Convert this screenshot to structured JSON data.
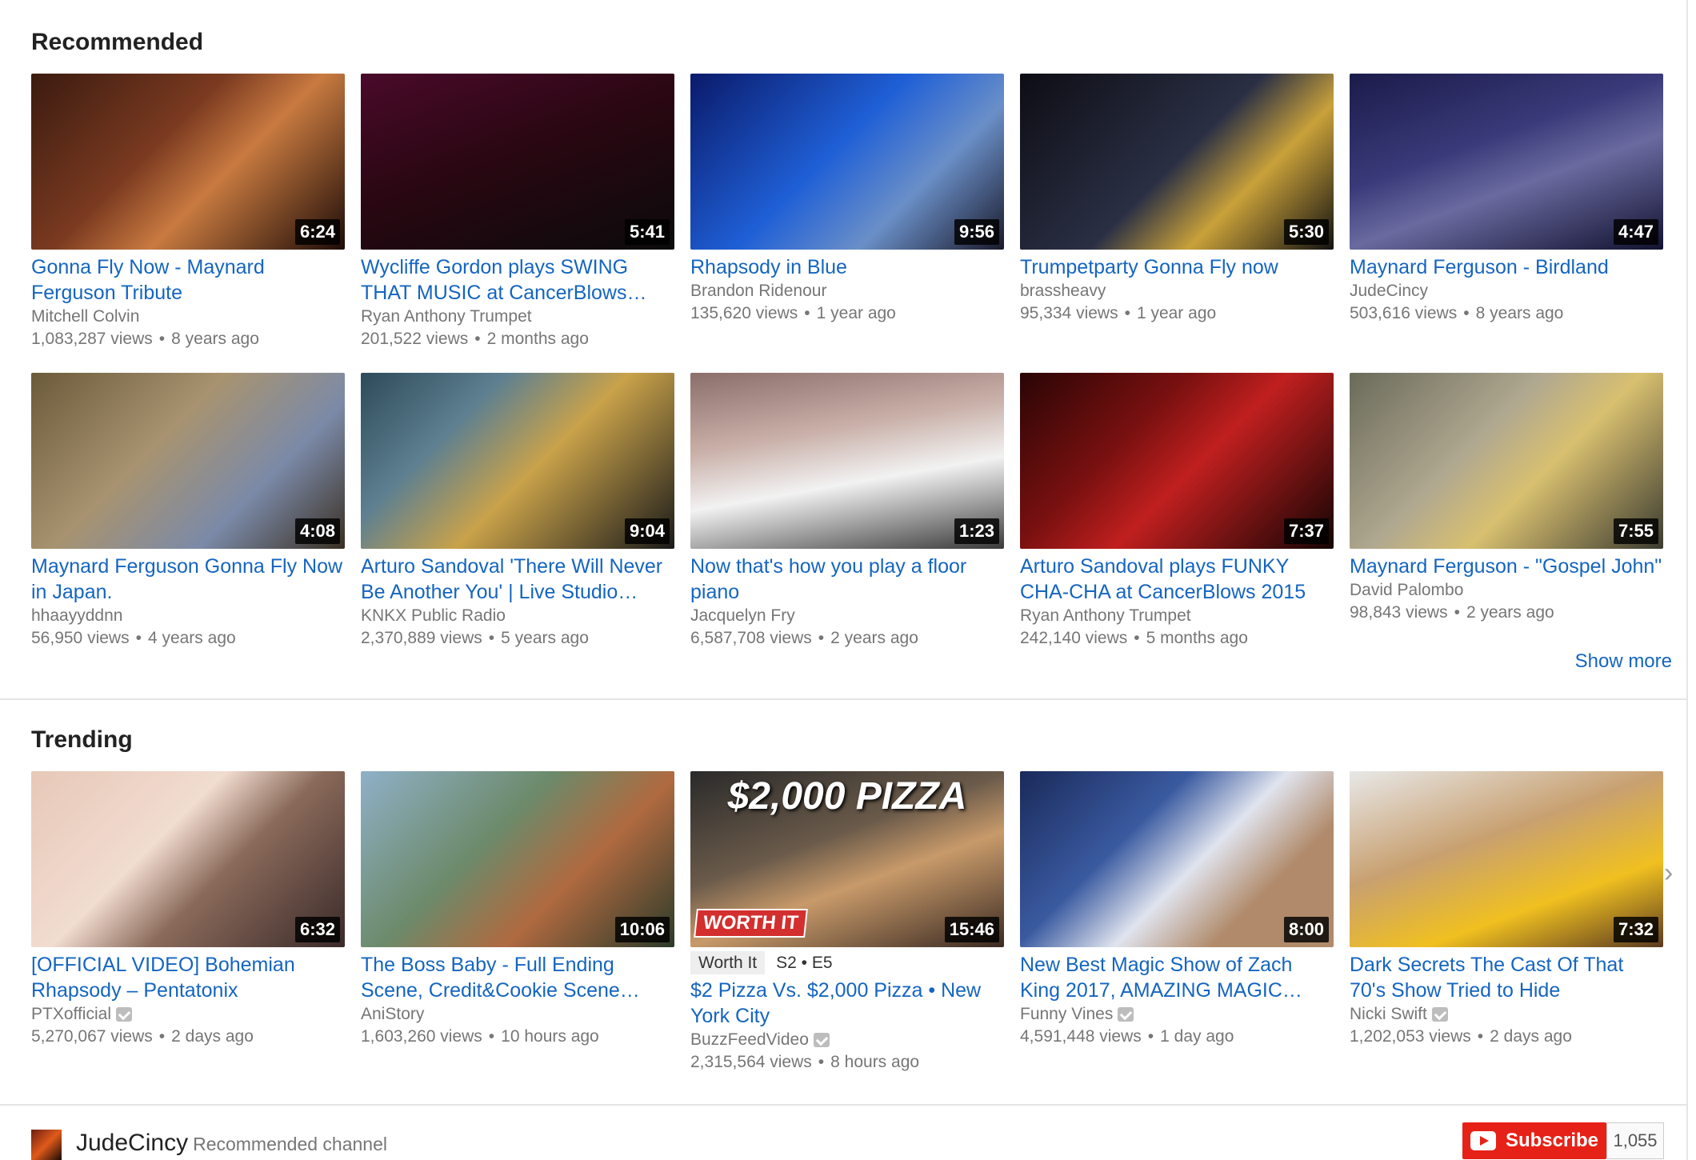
{
  "sections": {
    "recommended_title": "Recommended",
    "trending_title": "Trending",
    "show_more": "Show more"
  },
  "recommended": [
    {
      "title": "Gonna Fly Now - Maynard Ferguson Tribute",
      "channel": "Mitchell Colvin",
      "views": "1,083,287 views",
      "age": "8 years ago",
      "duration": "6:24"
    },
    {
      "title": "Wycliffe Gordon plays SWING THAT MUSIC at CancerBlows…",
      "channel": "Ryan Anthony Trumpet",
      "views": "201,522 views",
      "age": "2 months ago",
      "duration": "5:41"
    },
    {
      "title": "Rhapsody in Blue",
      "channel": "Brandon Ridenour",
      "views": "135,620 views",
      "age": "1 year ago",
      "duration": "9:56"
    },
    {
      "title": "Trumpetparty Gonna Fly now",
      "channel": "brassheavy",
      "views": "95,334 views",
      "age": "1 year ago",
      "duration": "5:30"
    },
    {
      "title": "Maynard Ferguson - Birdland",
      "channel": "JudeCincy",
      "views": "503,616 views",
      "age": "8 years ago",
      "duration": "4:47"
    },
    {
      "title": "Maynard Ferguson Gonna Fly Now in Japan.",
      "channel": "hhaayyddnn",
      "views": "56,950 views",
      "age": "4 years ago",
      "duration": "4:08"
    },
    {
      "title": "Arturo Sandoval 'There Will Never Be Another You' | Live Studio…",
      "channel": "KNKX Public Radio",
      "views": "2,370,889 views",
      "age": "5 years ago",
      "duration": "9:04"
    },
    {
      "title": "Now that's how you play a floor piano",
      "channel": "Jacquelyn Fry",
      "views": "6,587,708 views",
      "age": "2 years ago",
      "duration": "1:23"
    },
    {
      "title": "Arturo Sandoval plays FUNKY CHA-CHA at CancerBlows 2015",
      "channel": "Ryan Anthony Trumpet",
      "views": "242,140 views",
      "age": "5 months ago",
      "duration": "7:37"
    },
    {
      "title": "Maynard Ferguson - \"Gospel John\"",
      "channel": "David Palombo",
      "views": "98,843 views",
      "age": "2 years ago",
      "duration": "7:55"
    }
  ],
  "trending": [
    {
      "title": "[OFFICIAL VIDEO] Bohemian Rhapsody – Pentatonix",
      "channel": "PTXofficial",
      "views": "5,270,067 views",
      "age": "2 days ago",
      "duration": "6:32"
    },
    {
      "title": "The Boss Baby - Full Ending Scene, Credit&Cookie Scene…",
      "channel": "AniStory",
      "views": "1,603,260 views",
      "age": "10 hours ago",
      "duration": "10:06"
    },
    {
      "title": "$2 Pizza Vs. $2,000 Pizza • New York City",
      "channel": "BuzzFeedVideo",
      "views": "2,315,564 views",
      "age": "8 hours ago",
      "duration": "15:46",
      "overlay": "$2,000 PIZZA",
      "badge": "WORTH IT",
      "series_pill": "Worth It",
      "episode": "S2 • E5"
    },
    {
      "title": "New Best Magic Show of Zach King 2017, AMAZING MAGIC…",
      "channel": "Funny Vines",
      "views": "4,591,448 views",
      "age": "1 day ago",
      "duration": "8:00"
    },
    {
      "title": "Dark Secrets The Cast Of That 70's Show Tried to Hide",
      "channel": "Nicki Swift",
      "views": "1,202,053 views",
      "age": "2 days ago",
      "duration": "7:32"
    }
  ],
  "channel": {
    "name": "JudeCincy",
    "subtitle": "Recommended channel",
    "subscribe_label": "Subscribe",
    "subscriber_count": "1,055"
  }
}
